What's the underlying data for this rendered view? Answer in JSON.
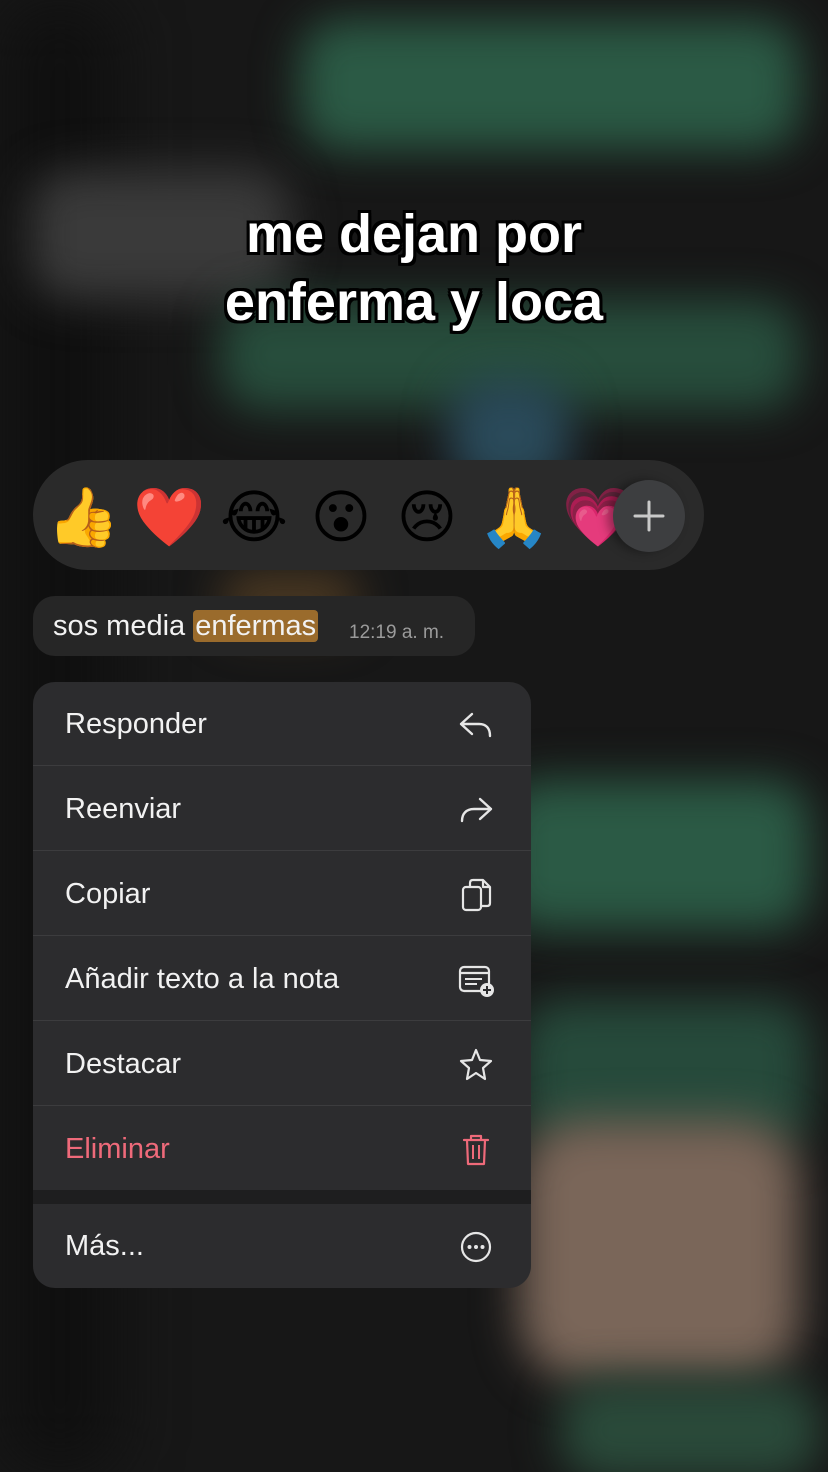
{
  "caption": {
    "line1": "me dejan por",
    "line2": "enferma y loca"
  },
  "reactions": {
    "emojis": [
      {
        "name": "thumbs-up-emoji",
        "char": "👍"
      },
      {
        "name": "red-heart-emoji",
        "char": "❤️"
      },
      {
        "name": "tears-of-joy-emoji",
        "char": "😂"
      },
      {
        "name": "surprised-face-emoji",
        "char": "😮"
      },
      {
        "name": "crying-face-emoji",
        "char": "😢"
      },
      {
        "name": "folded-hands-emoji",
        "char": "🙏"
      },
      {
        "name": "growing-heart-emoji",
        "char": "💗"
      }
    ],
    "more_icon": "plus-icon"
  },
  "message": {
    "text_before": "sos media ",
    "highlight": "enfermas",
    "time": "12:19 a. m."
  },
  "menu": {
    "items": [
      {
        "label": "Responder",
        "icon": "reply-icon"
      },
      {
        "label": "Reenviar",
        "icon": "forward-icon"
      },
      {
        "label": "Copiar",
        "icon": "copy-icon"
      },
      {
        "label": "Añadir texto a la nota",
        "icon": "add-note-icon"
      },
      {
        "label": "Destacar",
        "icon": "star-icon"
      },
      {
        "label": "Eliminar",
        "icon": "trash-icon"
      },
      {
        "label": "Más...",
        "icon": "more-icon"
      }
    ]
  },
  "colors": {
    "menu_background": "#2c2c2e",
    "danger": "#ef6a7a",
    "highlight": "#9a6b2c"
  }
}
